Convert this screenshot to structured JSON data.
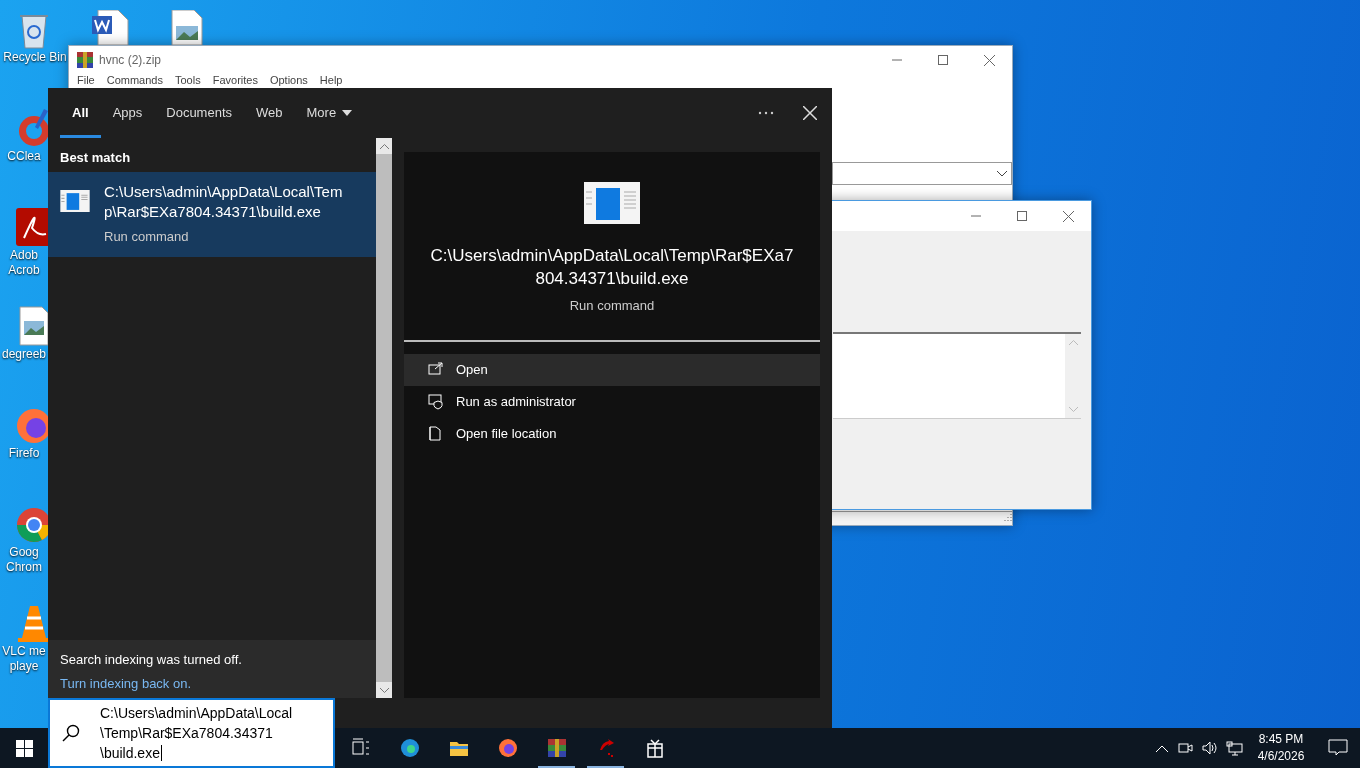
{
  "desktop_icons": [
    {
      "kind": "recycle",
      "lines": [
        "Recycle Bin"
      ]
    },
    {
      "kind": "ccleaner",
      "lines": [
        "CClea"
      ]
    },
    {
      "kind": "acrobat",
      "lines": [
        "Adob",
        "Acrob"
      ]
    },
    {
      "kind": "image",
      "lines": [
        "degreeb"
      ]
    },
    {
      "kind": "firefox",
      "lines": [
        "Firefo"
      ]
    },
    {
      "kind": "chrome",
      "lines": [
        "Goog",
        "Chrom"
      ]
    },
    {
      "kind": "vlc",
      "lines": [
        "VLC me",
        "playe"
      ]
    }
  ],
  "archive_window": {
    "title": "hvnc (2).zip",
    "menu": [
      "File",
      "Commands",
      "Tools",
      "Favorites",
      "Options",
      "Help"
    ]
  },
  "search": {
    "tabs": [
      {
        "label": "All",
        "selected": true,
        "kind": "plain"
      },
      {
        "label": "Apps",
        "selected": false,
        "kind": "plain"
      },
      {
        "label": "Documents",
        "selected": false,
        "kind": "plain"
      },
      {
        "label": "Web",
        "selected": false,
        "kind": "plain"
      },
      {
        "label": "More",
        "selected": false,
        "kind": "menu"
      }
    ],
    "heading": "Best match",
    "best_match": {
      "title": "C:\\Users\\admin\\AppData\\Local\\Temp\\Rar$EXa7804.34371\\build.exe",
      "subtitle": "Run command",
      "selected": true
    },
    "notice": "Search indexing was turned off.",
    "notice_link": "Turn indexing back on.",
    "preview": {
      "title": "C:\\Users\\admin\\AppData\\Local\\Temp\\Rar$EXa7804.34371\\build.exe",
      "subtitle": "Run command"
    },
    "actions": [
      {
        "kind": "open",
        "label": "Open",
        "selected": true
      },
      {
        "kind": "admin",
        "label": "Run as administrator",
        "selected": false
      },
      {
        "kind": "location",
        "label": "Open file location",
        "selected": false
      }
    ],
    "query": "C:\\Users\\admin\\AppData\\Local\\Temp\\Rar$EXa7804.34371\\build.exe"
  },
  "taskbar": {
    "apps": [
      {
        "kind": "task_view",
        "running": false
      },
      {
        "kind": "edge",
        "running": false
      },
      {
        "kind": "explorer",
        "running": false
      },
      {
        "kind": "firefox",
        "running": false
      },
      {
        "kind": "winrar",
        "running": true
      },
      {
        "kind": "arrow_app",
        "running": true
      },
      {
        "kind": "box_app",
        "running": false
      }
    ],
    "time": "8:45 PM",
    "date": "4/6/2026"
  }
}
